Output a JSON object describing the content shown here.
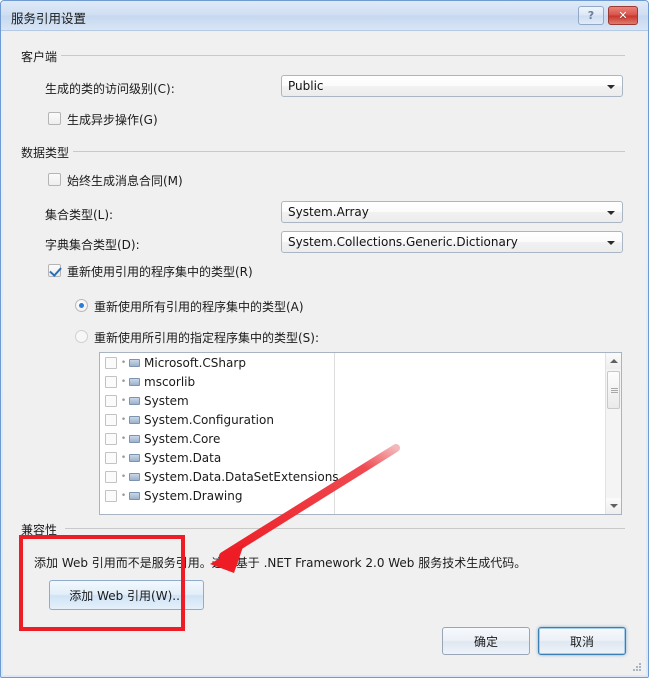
{
  "window": {
    "title": "服务引用设置",
    "help_button": "?",
    "close_button": "✕"
  },
  "colors": {
    "annotation": "#ee1c24",
    "titlebar_border": "#6f9bd1",
    "close_button": "#d9534a",
    "focus_border": "#3c7fb1"
  },
  "groups": {
    "client": {
      "label": "客户端"
    },
    "data_types": {
      "label": "数据类型"
    },
    "compatibility": {
      "label": "兼容性"
    }
  },
  "client_section": {
    "access_level_label": "生成的类的访问级别(C):",
    "access_level_value": "Public",
    "async_checkbox_label": "生成异步操作(G)",
    "async_checked": false
  },
  "data_types_section": {
    "message_contract_label": "始终生成消息合同(M)",
    "message_contract_checked": false,
    "collection_type_label": "集合类型(L):",
    "collection_type_value": "System.Array",
    "dictionary_type_label": "字典集合类型(D):",
    "dictionary_type_value": "System.Collections.Generic.Dictionary",
    "reuse_types_label": "重新使用引用的程序集中的类型(R)",
    "reuse_types_checked": true,
    "reuse_all_label": "重新使用所有引用的程序集中的类型(A)",
    "reuse_all_selected": true,
    "reuse_specified_label": "重新使用所引用的指定程序集中的类型(S):",
    "reuse_specified_selected": false,
    "assemblies": [
      {
        "name": "Microsoft.CSharp",
        "checked": false
      },
      {
        "name": "mscorlib",
        "checked": false
      },
      {
        "name": "System",
        "checked": false
      },
      {
        "name": "System.Configuration",
        "checked": false
      },
      {
        "name": "System.Core",
        "checked": false
      },
      {
        "name": "System.Data",
        "checked": false
      },
      {
        "name": "System.Data.DataSetExtensions",
        "checked": false
      },
      {
        "name": "System.Drawing",
        "checked": false
      }
    ]
  },
  "compatibility_section": {
    "description": "添加 Web 引用而不是服务引用。这将基于 .NET Framework 2.0 Web 服务技术生成代码。",
    "add_web_reference_button": "添加 Web 引用(W)..."
  },
  "footer": {
    "ok_button": "确定",
    "cancel_button": "取消"
  }
}
